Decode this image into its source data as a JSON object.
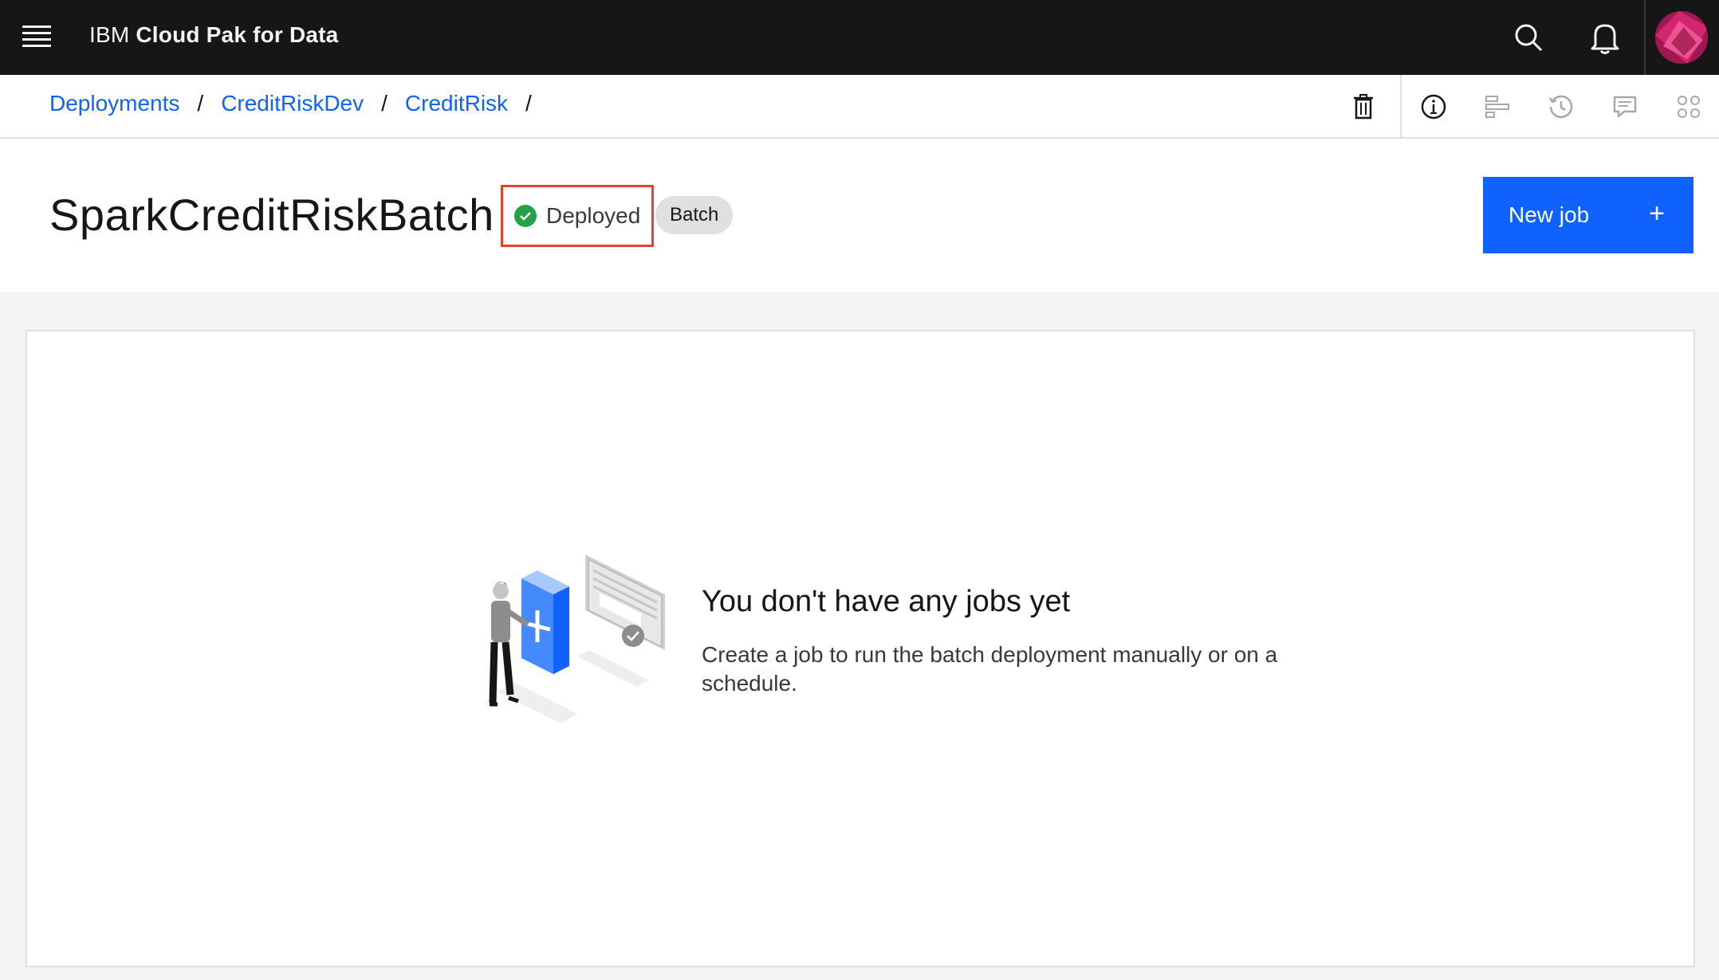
{
  "header": {
    "brand_prefix": "IBM",
    "brand_name": "Cloud Pak for Data",
    "icons": [
      "menu-icon",
      "search-icon",
      "notification-icon",
      "user-avatar"
    ]
  },
  "breadcrumb": {
    "items": [
      "Deployments",
      "CreditRiskDev",
      "CreditRisk"
    ],
    "separator": "/",
    "toolbar_icons": [
      "delete-icon",
      "information-icon",
      "details-icon",
      "history-icon",
      "comments-icon",
      "apps-icon"
    ]
  },
  "deployment": {
    "title": "SparkCreditRiskBatch",
    "status": "Deployed",
    "status_color": "#24a148",
    "tag": "Batch",
    "new_job_label": "New job"
  },
  "empty_state": {
    "title": "You don't have any jobs yet",
    "description": "Create a job to run the batch deployment manually or on a schedule."
  },
  "colors": {
    "accent": "#0f62fe",
    "header_bg": "#161616",
    "highlight_box": "#e8412c"
  }
}
